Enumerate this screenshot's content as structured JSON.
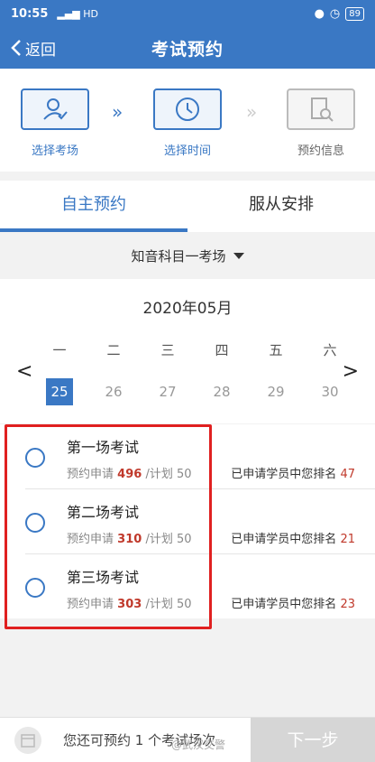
{
  "status": {
    "time": "10:55",
    "signal": "HD",
    "battery": "89"
  },
  "header": {
    "back_label": "返回",
    "title": "考试预约"
  },
  "steps": [
    {
      "label": "选择考场",
      "icon": "user-check-icon",
      "active": true
    },
    {
      "label": "选择时间",
      "icon": "clock-icon",
      "active": true
    },
    {
      "label": "预约信息",
      "icon": "document-search-icon",
      "active": false
    }
  ],
  "tabs": [
    {
      "label": "自主预约",
      "active": true
    },
    {
      "label": "服从安排",
      "active": false
    }
  ],
  "venue": {
    "label": "知音科目一考场"
  },
  "calendar": {
    "month": "2020年05月",
    "weekdays": [
      "一",
      "二",
      "三",
      "四",
      "五",
      "六"
    ],
    "dates": [
      "25",
      "26",
      "27",
      "28",
      "29",
      "30"
    ],
    "selected": "25"
  },
  "exams": [
    {
      "name": "第一场考试",
      "apply_label": "预约申请",
      "applied": "496",
      "plan_label": "/计划",
      "plan": "50",
      "rank_label": "已申请学员中您排名",
      "rank": "47"
    },
    {
      "name": "第二场考试",
      "apply_label": "预约申请",
      "applied": "310",
      "plan_label": "/计划",
      "plan": "50",
      "rank_label": "已申请学员中您排名",
      "rank": "21"
    },
    {
      "name": "第三场考试",
      "apply_label": "预约申请",
      "applied": "303",
      "plan_label": "/计划",
      "plan": "50",
      "rank_label": "已申请学员中您排名",
      "rank": "23"
    }
  ],
  "bottom": {
    "remaining_text": "您还可预约 1 个考试场次",
    "next_label": "下一步",
    "watermark": "@武汉交警"
  },
  "colors": {
    "accent": "#3a78c4",
    "highlight": "#e02020",
    "count": "#c0392b"
  }
}
